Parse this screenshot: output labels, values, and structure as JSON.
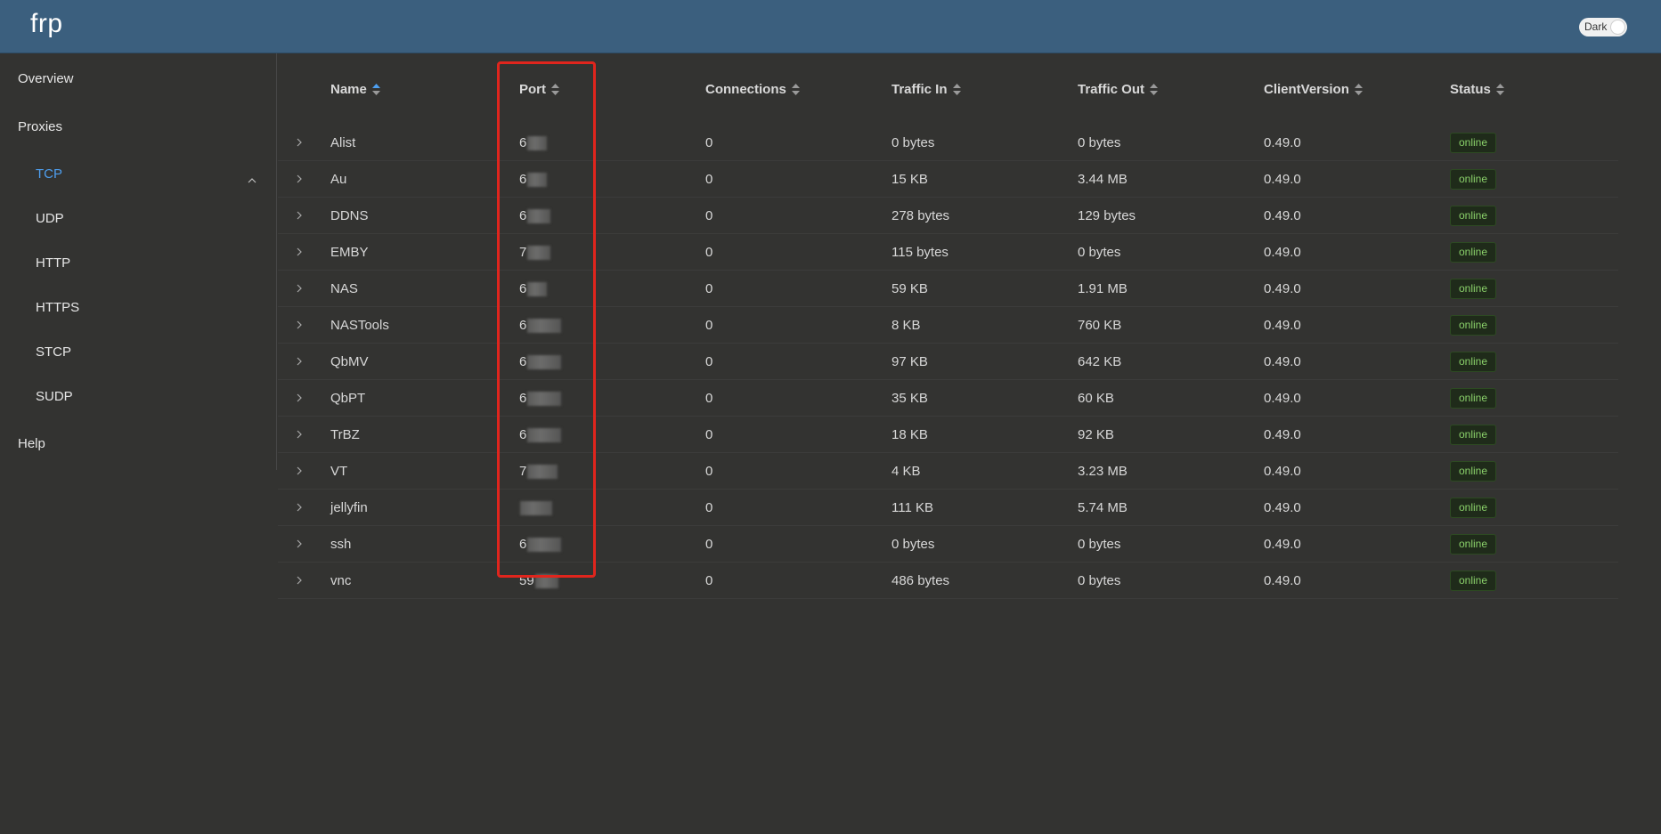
{
  "header": {
    "brand": "frp",
    "theme_toggle_label": "Dark"
  },
  "sidebar": {
    "items": [
      {
        "label": "Overview"
      },
      {
        "label": "Proxies",
        "expanded": true,
        "children": [
          {
            "label": "TCP",
            "active": true
          },
          {
            "label": "UDP"
          },
          {
            "label": "HTTP"
          },
          {
            "label": "HTTPS"
          },
          {
            "label": "STCP"
          },
          {
            "label": "SUDP"
          }
        ]
      },
      {
        "label": "Help"
      }
    ]
  },
  "table": {
    "columns": [
      "Name",
      "Port",
      "Connections",
      "Traffic In",
      "Traffic Out",
      "ClientVersion",
      "Status"
    ],
    "sorted_column": "Name",
    "rows": [
      {
        "name": "Alist",
        "port": "6",
        "connections": "0",
        "traffic_in": "0 bytes",
        "traffic_out": "0 bytes",
        "version": "0.49.0",
        "status": "online"
      },
      {
        "name": "Au",
        "port": "6",
        "connections": "0",
        "traffic_in": "15 KB",
        "traffic_out": "3.44 MB",
        "version": "0.49.0",
        "status": "online"
      },
      {
        "name": "DDNS",
        "port": "6",
        "connections": "0",
        "traffic_in": "278 bytes",
        "traffic_out": "129 bytes",
        "version": "0.49.0",
        "status": "online"
      },
      {
        "name": "EMBY",
        "port": "7",
        "connections": "0",
        "traffic_in": "115 bytes",
        "traffic_out": "0 bytes",
        "version": "0.49.0",
        "status": "online"
      },
      {
        "name": "NAS",
        "port": "6",
        "connections": "0",
        "traffic_in": "59 KB",
        "traffic_out": "1.91 MB",
        "version": "0.49.0",
        "status": "online"
      },
      {
        "name": "NASTools",
        "port": "6",
        "connections": "0",
        "traffic_in": "8 KB",
        "traffic_out": "760 KB",
        "version": "0.49.0",
        "status": "online"
      },
      {
        "name": "QbMV",
        "port": "6",
        "connections": "0",
        "traffic_in": "97 KB",
        "traffic_out": "642 KB",
        "version": "0.49.0",
        "status": "online"
      },
      {
        "name": "QbPT",
        "port": "6",
        "connections": "0",
        "traffic_in": "35 KB",
        "traffic_out": "60 KB",
        "version": "0.49.0",
        "status": "online"
      },
      {
        "name": "TrBZ",
        "port": "6",
        "connections": "0",
        "traffic_in": "18 KB",
        "traffic_out": "92 KB",
        "version": "0.49.0",
        "status": "online"
      },
      {
        "name": "VT",
        "port": "7",
        "connections": "0",
        "traffic_in": "4 KB",
        "traffic_out": "3.23 MB",
        "version": "0.49.0",
        "status": "online"
      },
      {
        "name": "jellyfin",
        "port": "",
        "connections": "0",
        "traffic_in": "111 KB",
        "traffic_out": "5.74 MB",
        "version": "0.49.0",
        "status": "online"
      },
      {
        "name": "ssh",
        "port": "6",
        "connections": "0",
        "traffic_in": "0 bytes",
        "traffic_out": "0 bytes",
        "version": "0.49.0",
        "status": "online"
      },
      {
        "name": "vnc",
        "port": "59",
        "connections": "0",
        "traffic_in": "486 bytes",
        "traffic_out": "0 bytes",
        "version": "0.49.0",
        "status": "online"
      }
    ]
  },
  "colors": {
    "header_bg": "#3b5f7e",
    "page_bg": "#333331",
    "active_nav": "#4e9ff0",
    "status_online": "#8ad16a",
    "highlight_box": "#e0251d"
  }
}
